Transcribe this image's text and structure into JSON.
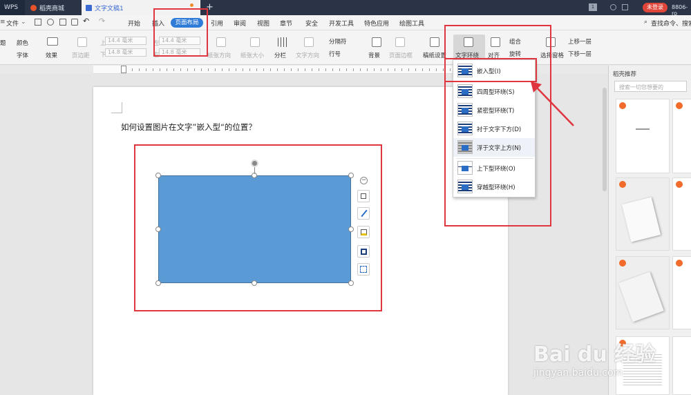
{
  "titlebar": {
    "wps": "WPS",
    "tab1": "稻壳商城",
    "tab2": "文字文稿1",
    "plus": "+",
    "page_num": "1",
    "login": "未登录",
    "id_text": "8806-ro"
  },
  "menubar": {
    "file": "文件",
    "items": [
      "开始",
      "插入",
      "页面布局",
      "引用",
      "审阅",
      "视图",
      "章节",
      "安全",
      "开发工具",
      "特色应用",
      "绘图工具"
    ],
    "search": "查找命令、搜索"
  },
  "ribbon": {
    "theme": "题",
    "color": "颜色",
    "font": "字体",
    "effect": "效果",
    "margin": "页边距",
    "top_label": "上",
    "bottom_label": "下",
    "left_label": "左",
    "right_label": "右",
    "spin_value": "14.4 毫米",
    "spin_value2": "14.8 毫米",
    "orientation": "纸张方向",
    "size": "纸张大小",
    "columns": "分栏",
    "textdir": "文字方向",
    "separator": "分隔符",
    "lineno": "行号",
    "background": "背景",
    "border": "页面边框",
    "paper": "稿纸设置",
    "wrap": "文字环绕",
    "align": "对齐",
    "group": "组合",
    "rotate": "旋转",
    "select_pane": "选择窗格",
    "up": "上移一层",
    "down": "下移一层"
  },
  "document": {
    "question": "如何设置图片在文字”嵌入型“的位置？"
  },
  "dropdown": {
    "items": [
      "嵌入型(I)",
      "四周型环绕(S)",
      "紧密型环绕(T)",
      "衬于文字下方(D)",
      "浮于文字上方(N)",
      "上下型环绕(O)",
      "穿越型环绕(H)"
    ]
  },
  "panel": {
    "title": "稻壳推荐",
    "search_placeholder": "搜索一切您想要的"
  },
  "watermark": {
    "brand": "Bai du 经验",
    "url": "jingyan.baidu.com"
  },
  "colors": {
    "shape": "#5b9bd5",
    "accent": "#e0353f",
    "brand": "#2b6cc4"
  }
}
